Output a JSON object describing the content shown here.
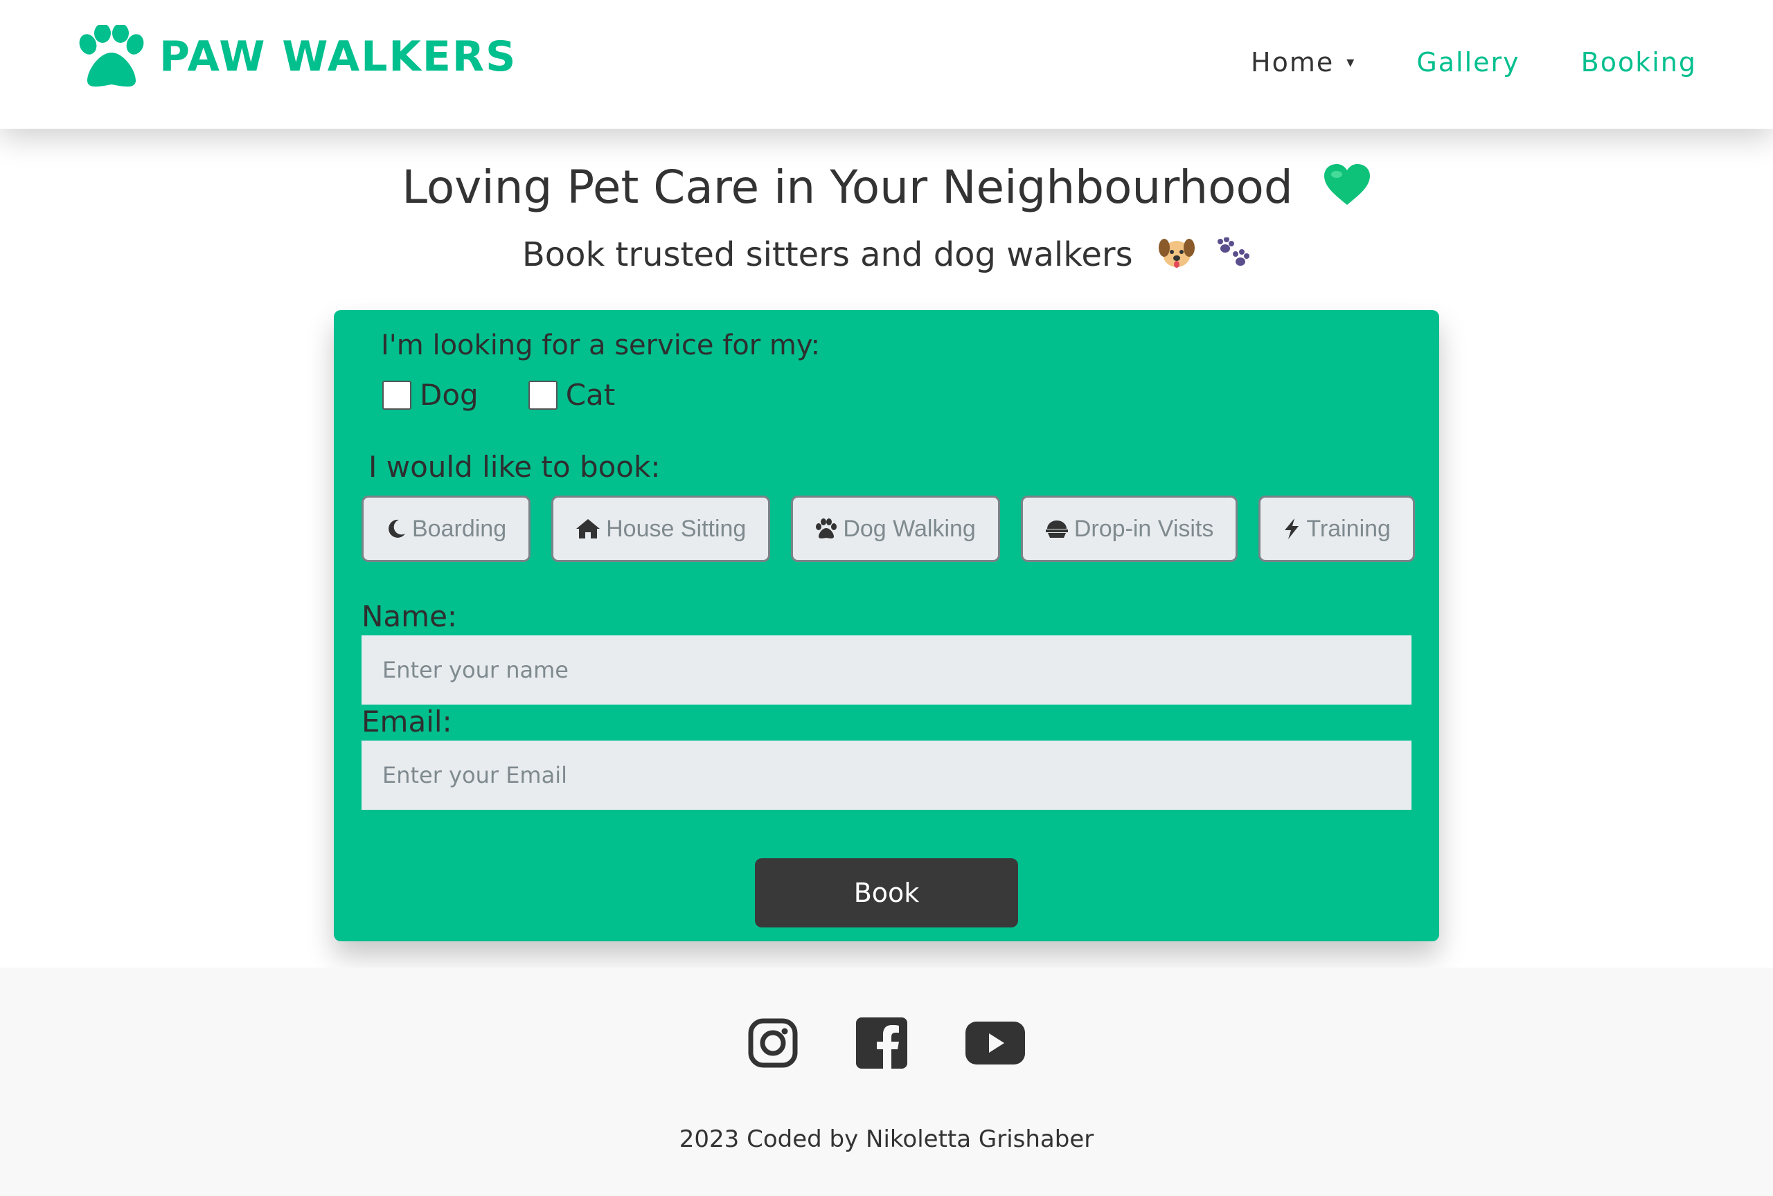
{
  "colors": {
    "brand": "#02bf8e",
    "dark": "#393939",
    "field_bg": "#e8ecef",
    "footer_bg": "#f8f8f8"
  },
  "header": {
    "brand_name": "PAW WALKERS",
    "logo_icon": "paw-icon",
    "nav": {
      "home": "Home",
      "gallery": "Gallery",
      "booking": "Booking"
    },
    "home_caret": "▾"
  },
  "hero": {
    "title": "Loving Pet Care in Your Neighbourhood",
    "title_emoji": "green-heart-icon",
    "subtitle": "Book trusted sitters and dog walkers",
    "subtitle_emojis": [
      "dog-face-icon",
      "paw-prints-icon"
    ]
  },
  "form": {
    "pet_question": "I'm looking for a service for my:",
    "pets": [
      {
        "label": "Dog",
        "checked": false
      },
      {
        "label": "Cat",
        "checked": false
      }
    ],
    "book_question": "I would like to book:",
    "services": [
      {
        "label": "Boarding",
        "icon": "moon-icon"
      },
      {
        "label": "House Sitting",
        "icon": "house-icon"
      },
      {
        "label": "Dog Walking",
        "icon": "paw-icon"
      },
      {
        "label": "Drop-in Visits",
        "icon": "bowl-icon"
      },
      {
        "label": "Training",
        "icon": "bolt-icon"
      }
    ],
    "name_label": "Name:",
    "name_placeholder": "Enter your name",
    "name_value": "",
    "email_label": "Email:",
    "email_placeholder": "Enter your Email",
    "email_value": "",
    "submit_label": "Book"
  },
  "footer": {
    "socials": [
      "instagram-icon",
      "facebook-icon",
      "youtube-icon"
    ],
    "credit": "2023 Coded by Nikoletta Grishaber"
  }
}
